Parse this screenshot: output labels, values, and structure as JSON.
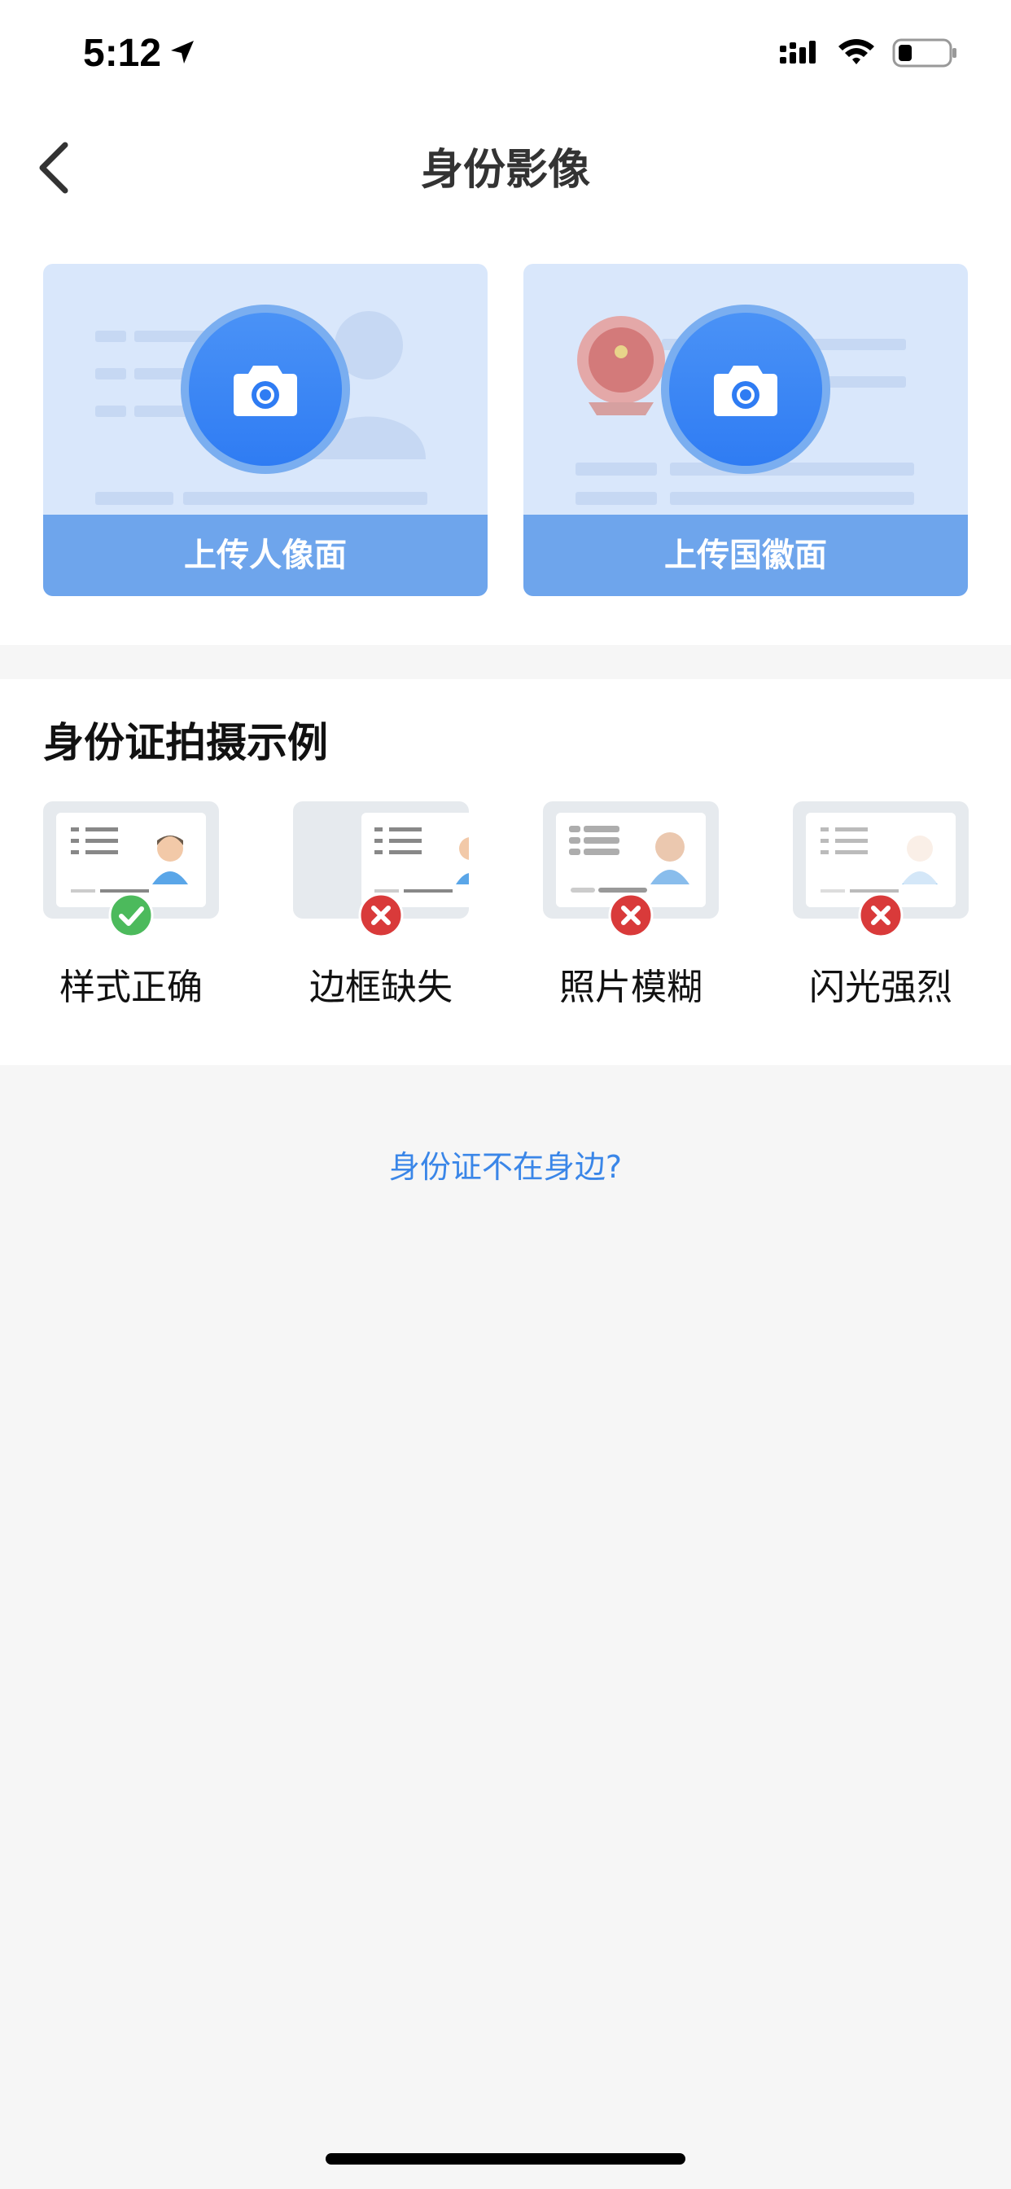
{
  "status_bar": {
    "time": "5:12"
  },
  "nav": {
    "title": "身份影像"
  },
  "upload": {
    "front_label": "上传人像面",
    "back_label": "上传国徽面"
  },
  "examples": {
    "title": "身份证拍摄示例",
    "items": [
      {
        "label": "样式正确",
        "status": "correct"
      },
      {
        "label": "边框缺失",
        "status": "wrong"
      },
      {
        "label": "照片模糊",
        "status": "wrong"
      },
      {
        "label": "闪光强烈",
        "status": "wrong"
      }
    ]
  },
  "link": {
    "text": "身份证不在身边?"
  },
  "colors": {
    "accent": "#3a86e8",
    "button": "#2f7cf3",
    "card_label": "#6ea5ec",
    "correct": "#4cba5c",
    "wrong": "#d93a3a"
  }
}
